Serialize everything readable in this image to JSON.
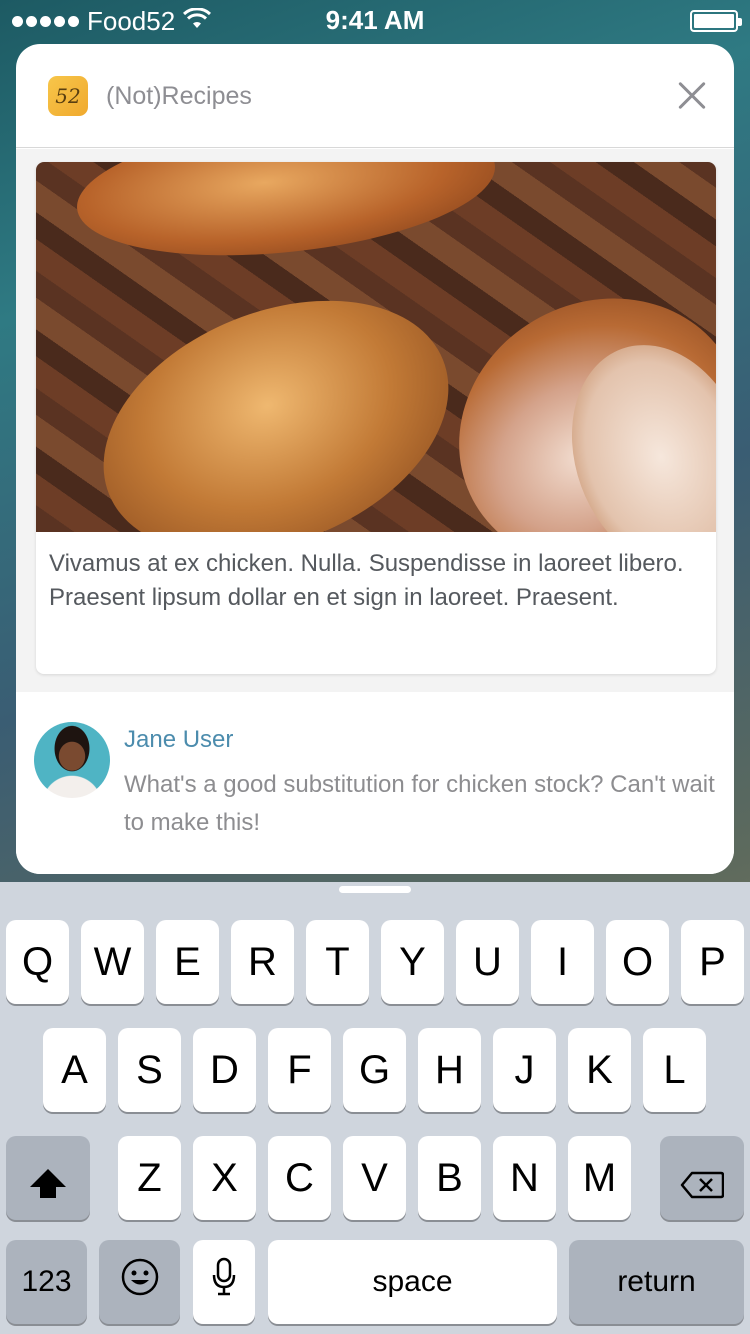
{
  "status_bar": {
    "carrier": "Food52",
    "time": "9:41 AM"
  },
  "notification": {
    "app_name": "(Not)Recipes",
    "app_icon_text": "52",
    "recipe_text": "Vivamus at ex chicken. Nulla. Suspendisse in laoreet libero. Praesent lipsum dollar en et sign in laoreet. Praesent.",
    "comment_author": "Jane User",
    "comment_text": "What's a good substitution for chicken stock? Can't wait to make this!"
  },
  "keyboard": {
    "row1": [
      "Q",
      "W",
      "E",
      "R",
      "T",
      "Y",
      "U",
      "I",
      "O",
      "P"
    ],
    "row2": [
      "A",
      "S",
      "D",
      "F",
      "G",
      "H",
      "J",
      "K",
      "L"
    ],
    "row3": [
      "Z",
      "X",
      "C",
      "V",
      "B",
      "N",
      "M"
    ],
    "numbers_label": "123",
    "space_label": "space",
    "return_label": "return"
  }
}
